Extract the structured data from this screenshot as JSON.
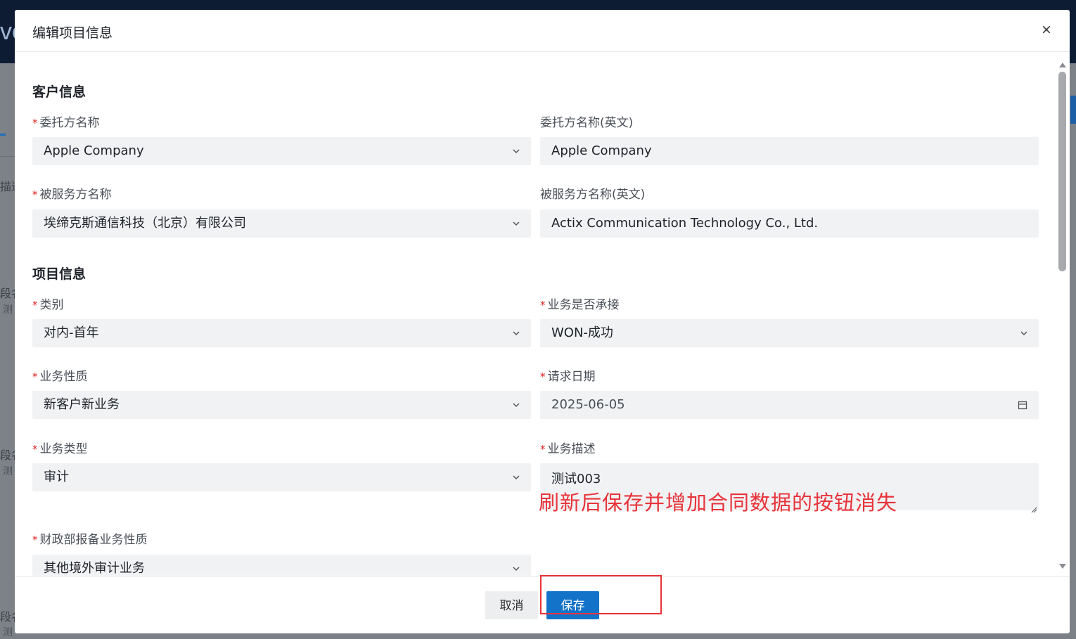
{
  "background": {
    "logo_fragment": "ve",
    "fragments": [
      "描述",
      "段名",
      "测",
      "段名",
      "测",
      "段名",
      "测"
    ]
  },
  "dialog": {
    "title": "编辑项目信息",
    "close_label": "×"
  },
  "sections": {
    "customer": "客户信息",
    "project": "项目信息"
  },
  "required_mark": "*",
  "fields": {
    "client_name": {
      "label": "委托方名称",
      "value": "Apple Company",
      "icon": "chevron-down-icon"
    },
    "client_name_en": {
      "label": "委托方名称(英文)",
      "value": "Apple Company"
    },
    "served_name": {
      "label": "被服务方名称",
      "value": "埃缔克斯通信科技（北京）有限公司",
      "icon": "chevron-down-icon"
    },
    "served_name_en": {
      "label": "被服务方名称(英文)",
      "value": "Actix Communication Technology Co., Ltd."
    },
    "category": {
      "label": "类别",
      "value": "对内-首年",
      "icon": "chevron-down-icon"
    },
    "undertaken": {
      "label": "业务是否承接",
      "value": "WON-成功",
      "icon": "chevron-down-icon"
    },
    "business_nature": {
      "label": "业务性质",
      "value": "新客户新业务",
      "icon": "chevron-down-icon"
    },
    "request_date": {
      "label": "请求日期",
      "value": "2025-06-05",
      "icon": "calendar-icon"
    },
    "business_type": {
      "label": "业务类型",
      "value": "审计",
      "icon": "chevron-down-icon"
    },
    "business_desc": {
      "label": "业务描述",
      "value": "测试003"
    },
    "mof_nature": {
      "label": "财政部报备业务性质",
      "value": "其他境外审计业务",
      "icon": "chevron-down-icon"
    }
  },
  "annotation_text": "刷新后保存并增加合同数据的按钮消失",
  "footer": {
    "cancel_label": "取消",
    "save_label": "保存"
  },
  "colors": {
    "primary": "#1273c9",
    "required": "#e02424",
    "annotation": "#e8333a"
  }
}
